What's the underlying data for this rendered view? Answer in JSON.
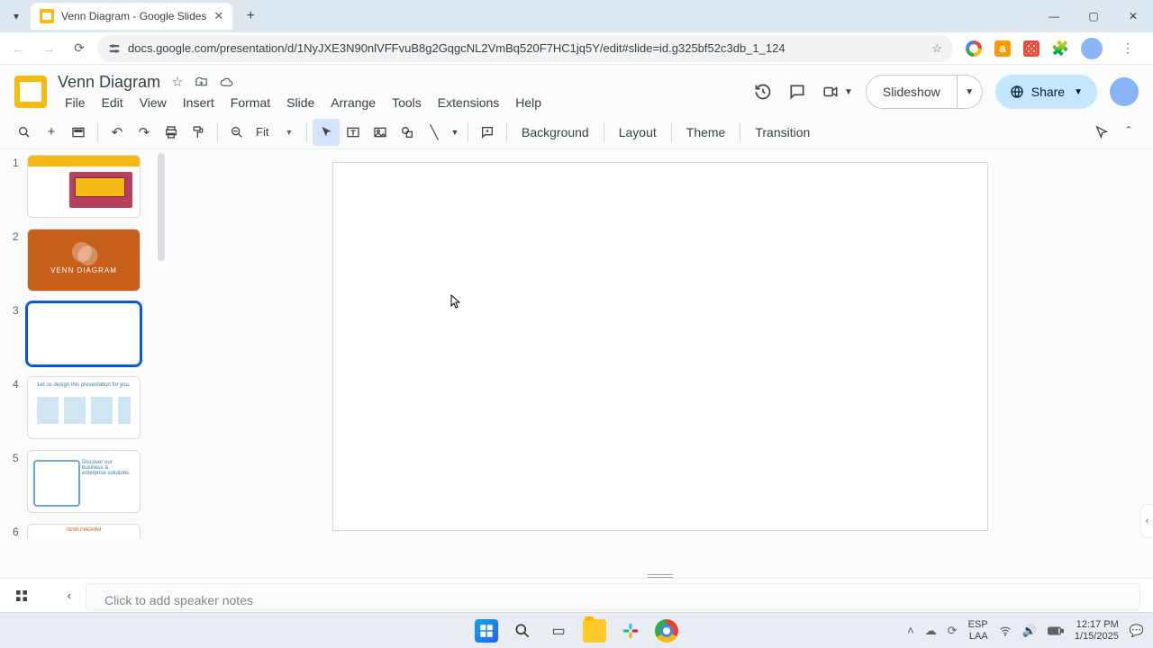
{
  "browser": {
    "tab_title": "Venn Diagram - Google Slides",
    "url": "docs.google.com/presentation/d/1NyJXE3N90nlVFFvuB8g2GqgcNL2VmBq520F7HC1jq5Y/edit#slide=id.g325bf52c3db_1_124"
  },
  "doc": {
    "title": "Venn Diagram",
    "menus": {
      "file": "File",
      "edit": "Edit",
      "view": "View",
      "insert": "Insert",
      "format": "Format",
      "slide": "Slide",
      "arrange": "Arrange",
      "tools": "Tools",
      "extensions": "Extensions",
      "help": "Help"
    },
    "slideshow": "Slideshow",
    "share": "Share"
  },
  "toolbar": {
    "zoom": "Fit",
    "background": "Background",
    "layout": "Layout",
    "theme": "Theme",
    "transition": "Transition"
  },
  "filmstrip": {
    "slides": [
      {
        "n": "1"
      },
      {
        "n": "2",
        "label": "VENN DIAGRAM"
      },
      {
        "n": "3"
      },
      {
        "n": "4",
        "label": "Let us design this presentation for you."
      },
      {
        "n": "5",
        "label": "Discover our business & enterprise solutions"
      },
      {
        "n": "6",
        "label": "VENN DIAGRAM"
      }
    ]
  },
  "notes": {
    "placeholder": "Click to add speaker notes"
  },
  "taskbar": {
    "lang1": "ESP",
    "lang2": "LAA",
    "time": "12:17 PM",
    "date": "1/15/2025"
  }
}
